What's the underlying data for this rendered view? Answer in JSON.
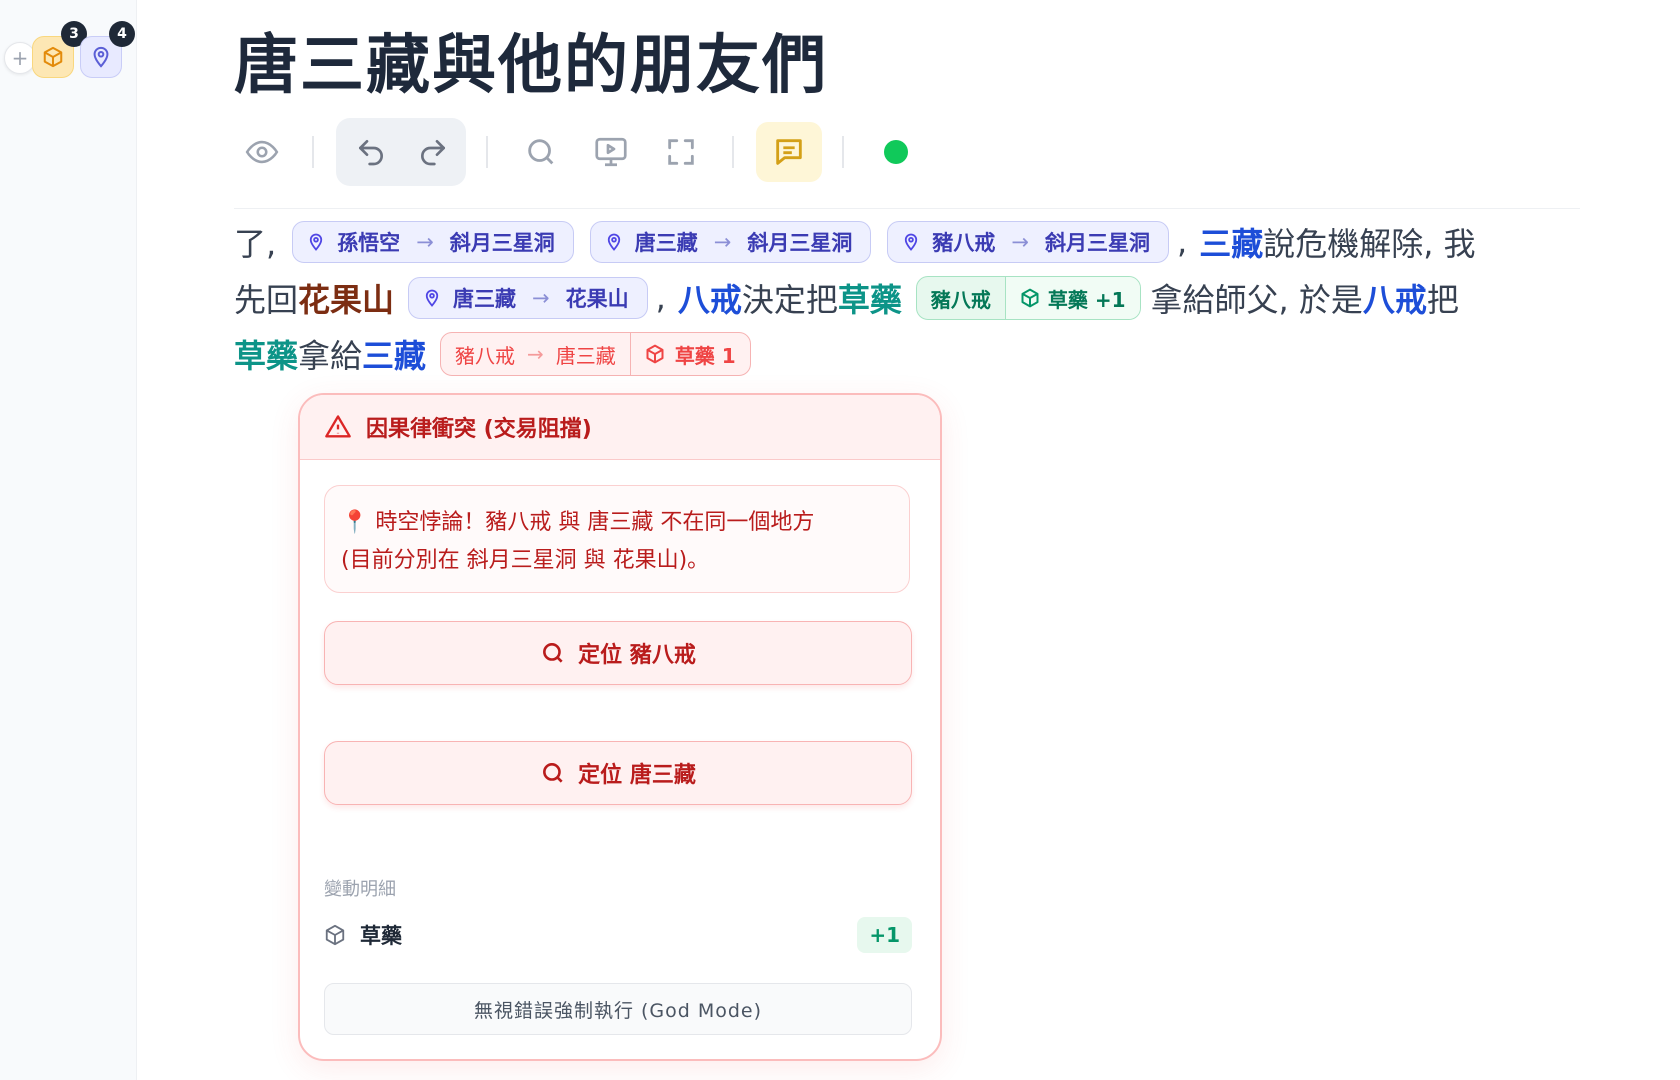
{
  "rail": {
    "box_count": "3",
    "pin_count": "4"
  },
  "document": {
    "title": "唐三藏與他的朋友們"
  },
  "paragraph": {
    "t1": "了,",
    "chip1": {
      "who": "孫悟空",
      "arrow": "→",
      "where": "斜月三星洞"
    },
    "chip2": {
      "who": "唐三藏",
      "arrow": "→",
      "where": "斜月三星洞"
    },
    "chip3": {
      "who": "豬八戒",
      "arrow": "→",
      "where": "斜月三星洞"
    },
    "t2": ",",
    "h1": "三藏",
    "t3": "說危機解除, 我",
    "t4": "先回",
    "h2": "花果山",
    "chip4": {
      "who": "唐三藏",
      "arrow": "→",
      "where": "花果山"
    },
    "t5": ",",
    "h3": "八戒",
    "t6": "決定把",
    "h4": "草藥",
    "chip5": {
      "who": "豬八戒",
      "item": "草藥 +1"
    },
    "t7": "拿給師父, 於是",
    "h5": "八戒",
    "t8": "把",
    "h6": "草藥",
    "t9": "拿給",
    "h7": "三藏",
    "chip6": {
      "from": "豬八戒",
      "arrow": "→",
      "to": "唐三藏",
      "item": "草藥 1"
    }
  },
  "conflict": {
    "title": "因果律衝突 (交易阻擋)",
    "message_line1": "📍 時空悖論！豬八戒 與 唐三藏 不在同一個地方",
    "message_line2": "(目前分別在 斜月三星洞 與 花果山)。",
    "locate1": "定位 豬八戒",
    "locate2": "定位 唐三藏",
    "details_title": "變動明細",
    "detail_item": "草藥",
    "detail_delta": "+1",
    "god_mode": "無視錯誤強制執行 (God Mode)"
  },
  "colors": {
    "accent_blue": "#1d4ed8",
    "accent_teal": "#0d9488",
    "accent_brown": "#7c2d12",
    "danger": "#b91c1c",
    "online": "#10c95a"
  },
  "icons": [
    "plus-icon",
    "box-icon",
    "map-pin-icon",
    "eye-icon",
    "undo-icon",
    "redo-icon",
    "search-icon",
    "presentation-icon",
    "fullscreen-icon",
    "comment-icon",
    "alert-triangle-icon"
  ]
}
